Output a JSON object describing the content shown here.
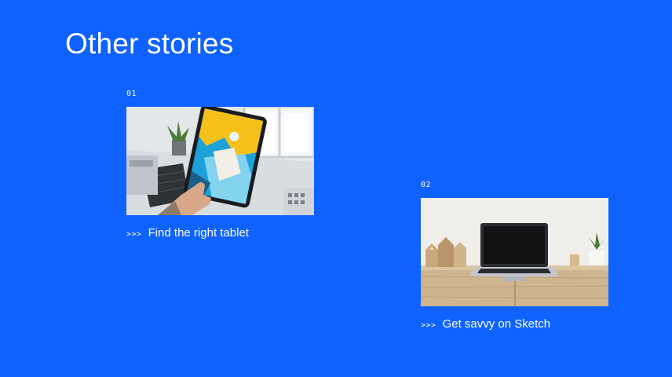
{
  "section": {
    "title": "Other stories"
  },
  "stories": [
    {
      "number": "01",
      "chevrons": ">>>",
      "title": "Find the right tablet",
      "image": "tablet-in-hand-photo"
    },
    {
      "number": "02",
      "chevrons": ">>>",
      "title": "Get savvy on Sketch",
      "image": "laptop-on-desk-photo"
    }
  ],
  "colors": {
    "background": "#0f62fe",
    "text": "#ffffff"
  }
}
